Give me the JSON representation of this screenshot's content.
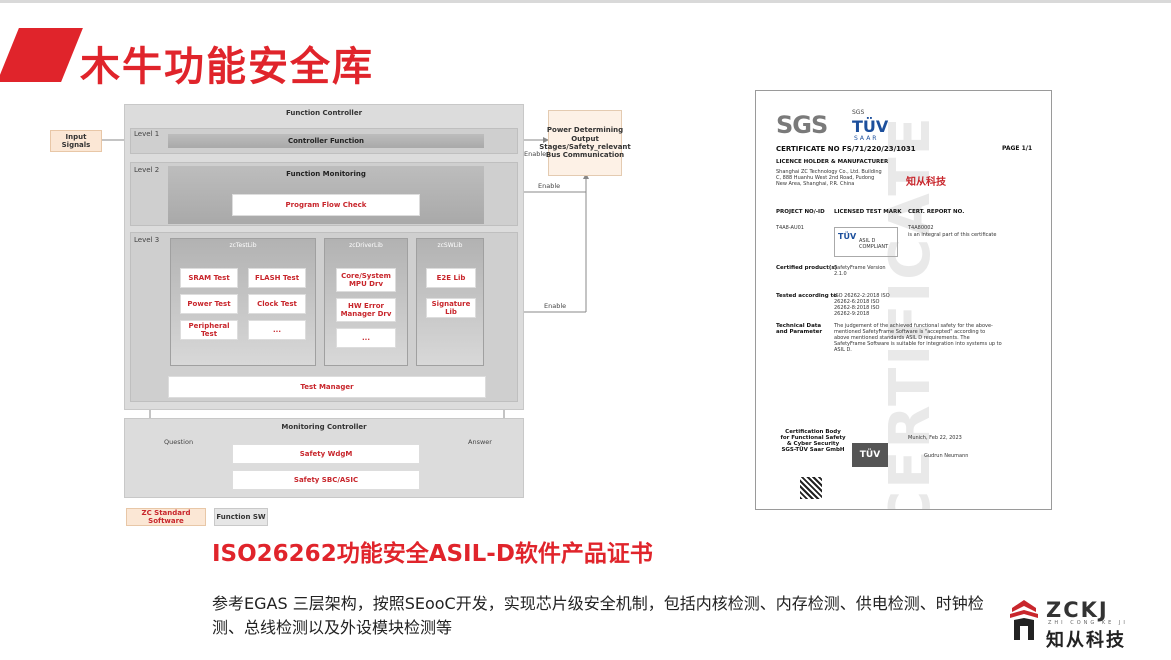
{
  "title": "木牛功能安全库",
  "diagram": {
    "outer_title": "Function Controller",
    "level1": "Level 1",
    "level2": "Level 2",
    "level3": "Level 3",
    "input_signals": "Input Signals",
    "controller_function": "Controller Function",
    "function_monitoring": "Function Monitoring",
    "program_flow_check": "Program Flow Check",
    "power_box": "Power Determining Output Stages/Safety_relevant Bus Communication",
    "enable1": "Enable",
    "enable2": "Enable",
    "enable3": "Enable",
    "testlib": "zcTestLib",
    "driverlib": "zcDriverLib",
    "swlib": "zcSWLib",
    "sram_test": "SRAM Test",
    "flash_test": "FLASH Test",
    "power_test": "Power Test",
    "clock_test": "Clock Test",
    "peripheral_test": "Peripheral Test",
    "ellipsis1": "...",
    "core_mpu": "Core/System MPU Drv",
    "hw_error": "HW Error Manager Drv",
    "ellipsis2": "...",
    "e2e_lib": "E2E Lib",
    "signature_lib": "Signature Lib",
    "test_manager": "Test Manager",
    "monitoring_controller": "Monitoring Controller",
    "question": "Question",
    "answer": "Answer",
    "safety_wdgm": "Safety WdgM",
    "safety_sbc": "Safety SBC/ASIC",
    "legend_zc": "ZC Standard Software",
    "legend_fn": "Function SW"
  },
  "certificate": {
    "sgs": "SGS",
    "sgs_small": "SGS",
    "tuv": "TÜV",
    "saar": "SAAR",
    "cert_no": "CERTIFICATE NO FS/71/220/23/1031",
    "page": "PAGE 1/1",
    "holder_label": "LICENCE HOLDER & MANUFACTURER",
    "holder_address": "Shanghai ZC Technology Co., Ltd. Building C, 888 Huanhu West 2nd Road, Pudong New Area, Shanghai, P.R. China",
    "zc_logo": "知从科技",
    "project_label": "PROJECT NO/-ID",
    "project_value": "T4A8-AU01",
    "trademark_label": "LICENSED TEST MARK",
    "report_label": "CERT. REPORT NO.",
    "report_value": "T4A80002",
    "report_note": "is an integral part of this certificate",
    "mark_text": "ASIL D COMPLIANT",
    "products_label": "Certified product(s)",
    "products_value": "SafetyFrame Version 2.1.0",
    "tested_label": "Tested according to",
    "tested_value": "ISO 26262-2:2018 ISO 26262-6:2018 ISO 26262-8:2018 ISO 26262-9:2018",
    "tech_label": "Technical Data and Parameter",
    "tech_value": "The judgement of the achieved functional safety for the above-mentioned SafetyFrame Software is \"accepted\" according to above mentioned standards ASIL D requirements. The SafetyFrame Software is suitable for integration into systems up to ASIL D.",
    "body_label": "Certification Body for Functional Safety & Cyber Security SGS-TÜV Saar GmbH",
    "date_place": "Munich, Feb 22, 2023",
    "signer": "Gudrun Neumann",
    "stamp": "TÜV",
    "watermark": "CERTIFICATE"
  },
  "subtitle": "ISO26262功能安全ASIL-D软件产品证书",
  "description": "参考EGAS 三层架构，按照SEooC开发，实现芯片级安全机制，包括内核检测、内存检测、供电检测、时钟检测、总线检测以及外设模块检测等",
  "logo": {
    "en": "ZCKJ",
    "pinyin": "ZHI CONG KE JI",
    "cn": "知从科技"
  },
  "colors": {
    "brand_red": "#e0242b"
  }
}
